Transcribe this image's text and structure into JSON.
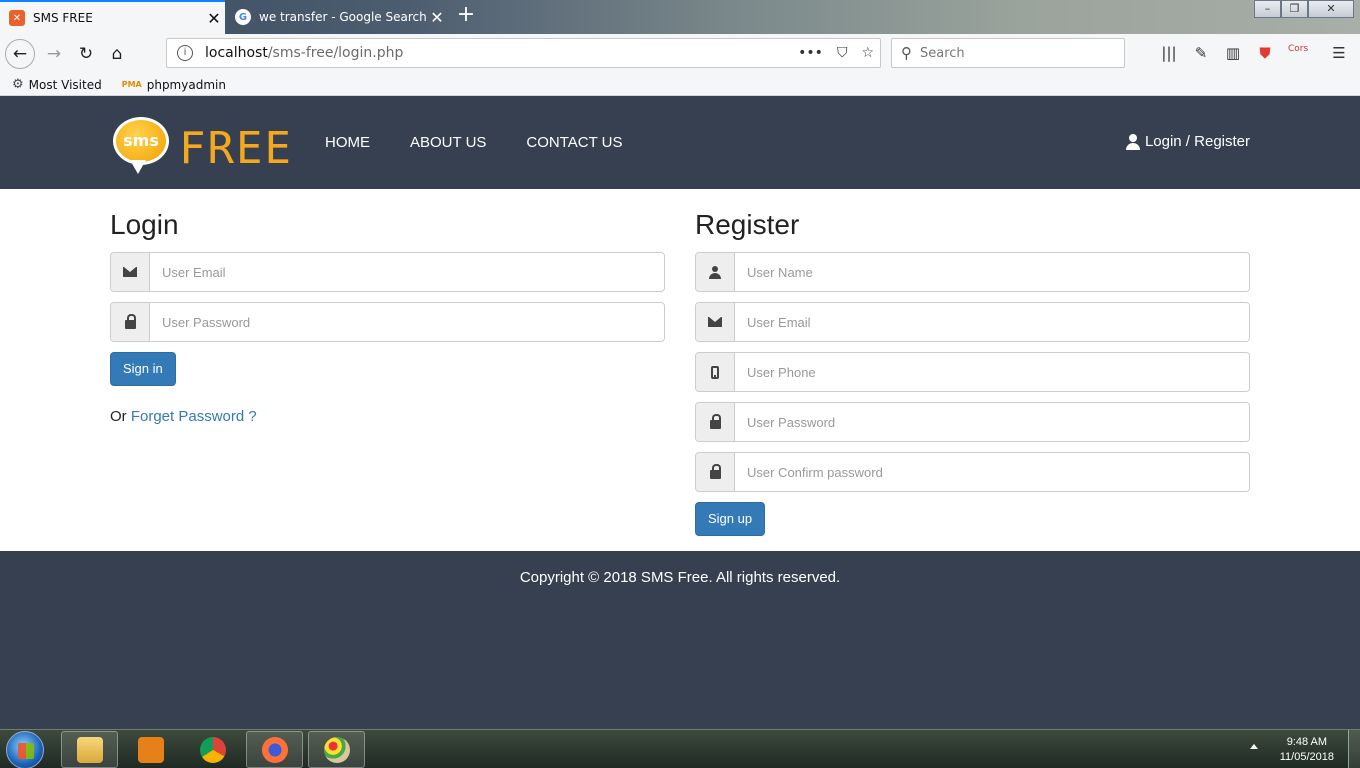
{
  "browser": {
    "tabs": [
      {
        "title": "SMS FREE",
        "active": true
      },
      {
        "title": "we transfer - Google Search",
        "active": false
      }
    ],
    "url_host": "localhost",
    "url_path": "/sms-free/login.php",
    "search_placeholder": "Search",
    "bookmarks": [
      {
        "label": "Most Visited",
        "icon": "gear-icon"
      },
      {
        "label": "phpmyadmin",
        "icon": "phpmyadmin-icon"
      }
    ]
  },
  "site": {
    "logo_badge": "sms",
    "logo_text": "FREE",
    "nav": [
      "HOME",
      "ABOUT US",
      "CONTACT US"
    ],
    "login_register": "Login / Register",
    "colors": {
      "header_bg": "#374050",
      "accent": "#f4a81c",
      "button": "#337ab7"
    }
  },
  "login": {
    "title": "Login",
    "email_placeholder": "User Email",
    "password_placeholder": "User Password",
    "submit": "Sign in",
    "forgot_prefix": "Or",
    "forgot_link": "Forget Password ?"
  },
  "register": {
    "title": "Register",
    "name_placeholder": "User Name",
    "email_placeholder": "User Email",
    "phone_placeholder": "User Phone",
    "password_placeholder": "User Password",
    "confirm_placeholder": "User Confirm password",
    "submit": "Sign up"
  },
  "footer": {
    "copyright": "Copyright © 2018 SMS Free. All rights reserved."
  },
  "taskbar": {
    "time": "9:48 AM",
    "date": "11/05/2018",
    "apps": [
      "file-explorer-icon",
      "sublime-text-icon",
      "chrome-icon",
      "firefox-icon",
      "paint-icon"
    ]
  }
}
